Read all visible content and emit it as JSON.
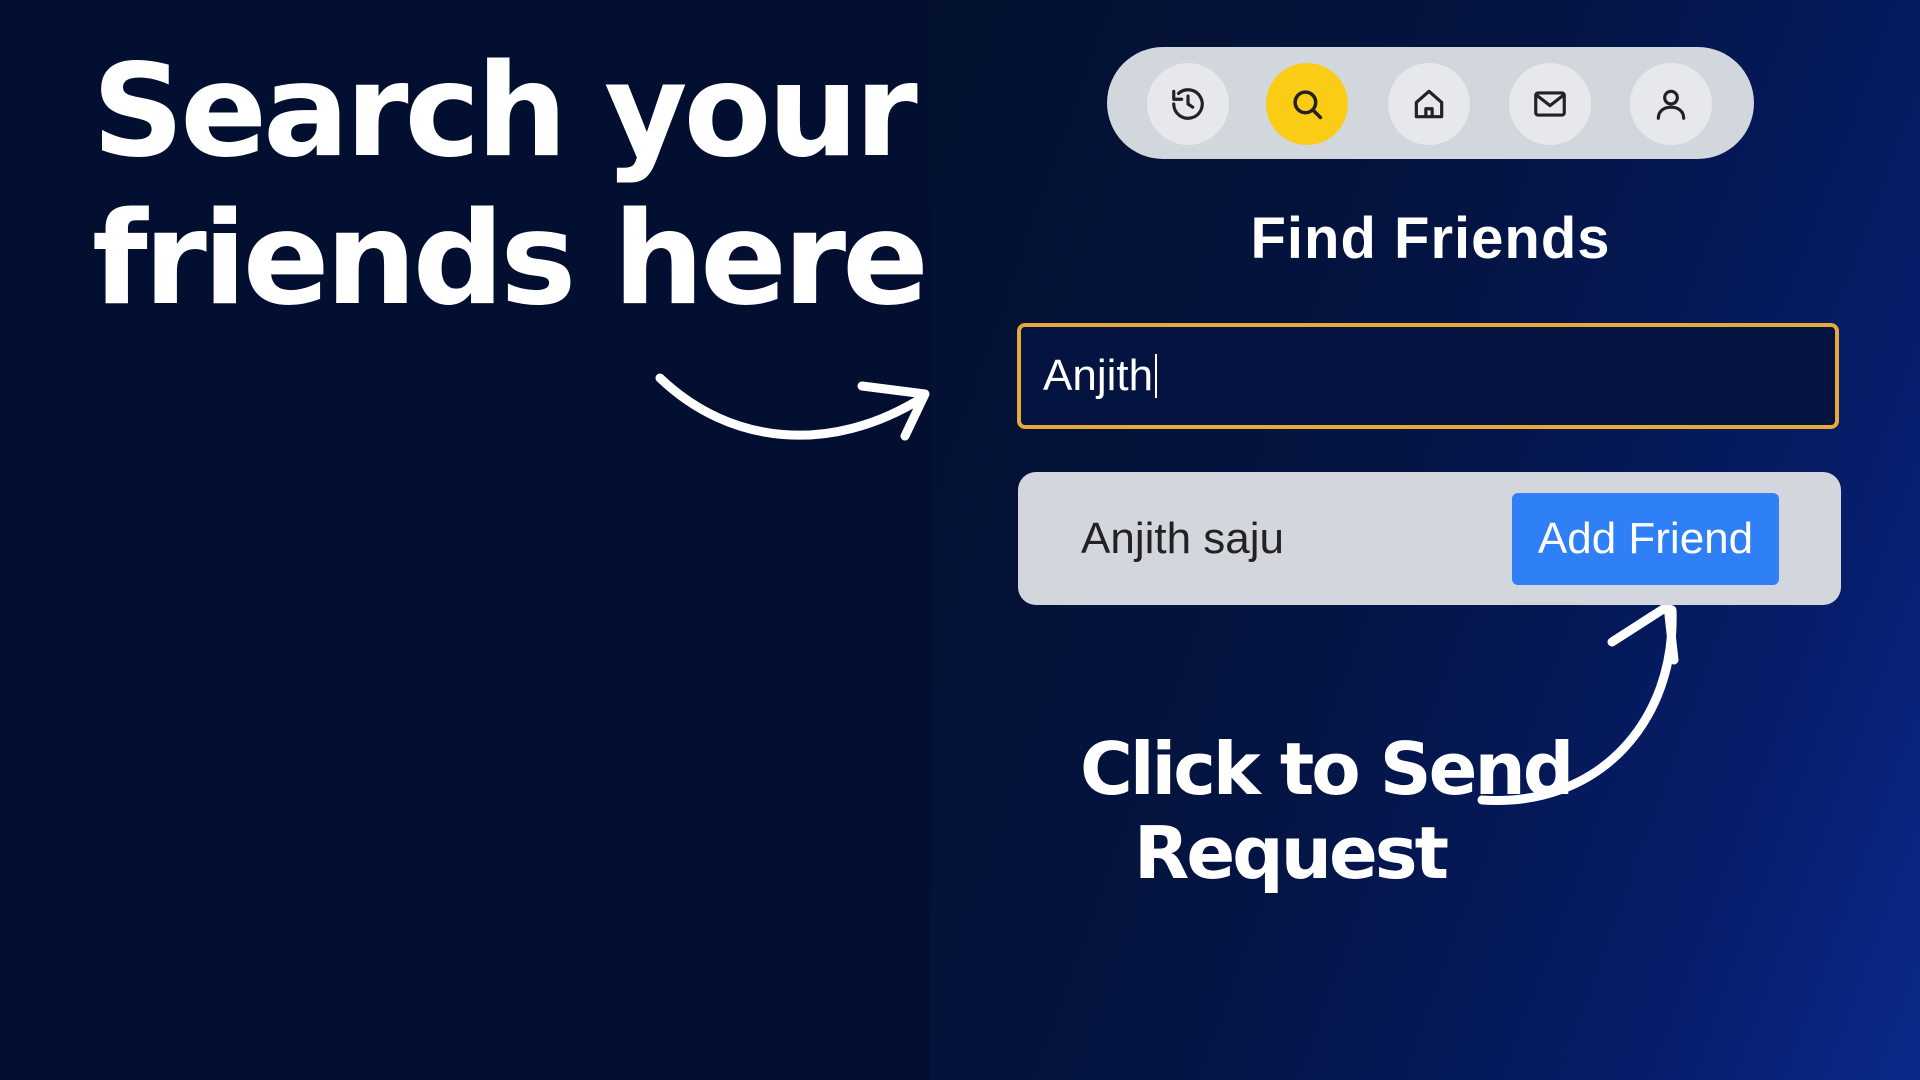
{
  "annotation": {
    "headline_lines": [
      "Search your",
      "friends here"
    ],
    "caption_lines": [
      "Click to Send",
      "Request"
    ]
  },
  "nav": {
    "items": [
      {
        "icon": "history-icon",
        "active": false
      },
      {
        "icon": "search-icon",
        "active": true
      },
      {
        "icon": "home-icon",
        "active": false
      },
      {
        "icon": "mail-icon",
        "active": false
      },
      {
        "icon": "user-icon",
        "active": false
      }
    ]
  },
  "page": {
    "title": "Find Friends"
  },
  "search": {
    "value": "Anjith"
  },
  "results": [
    {
      "name": "Anjith saju",
      "action_label": "Add Friend"
    }
  ],
  "colors": {
    "accent": "#facc15",
    "button": "#2f80f7",
    "input_border": "#e6a93a",
    "background": "#020f31"
  }
}
